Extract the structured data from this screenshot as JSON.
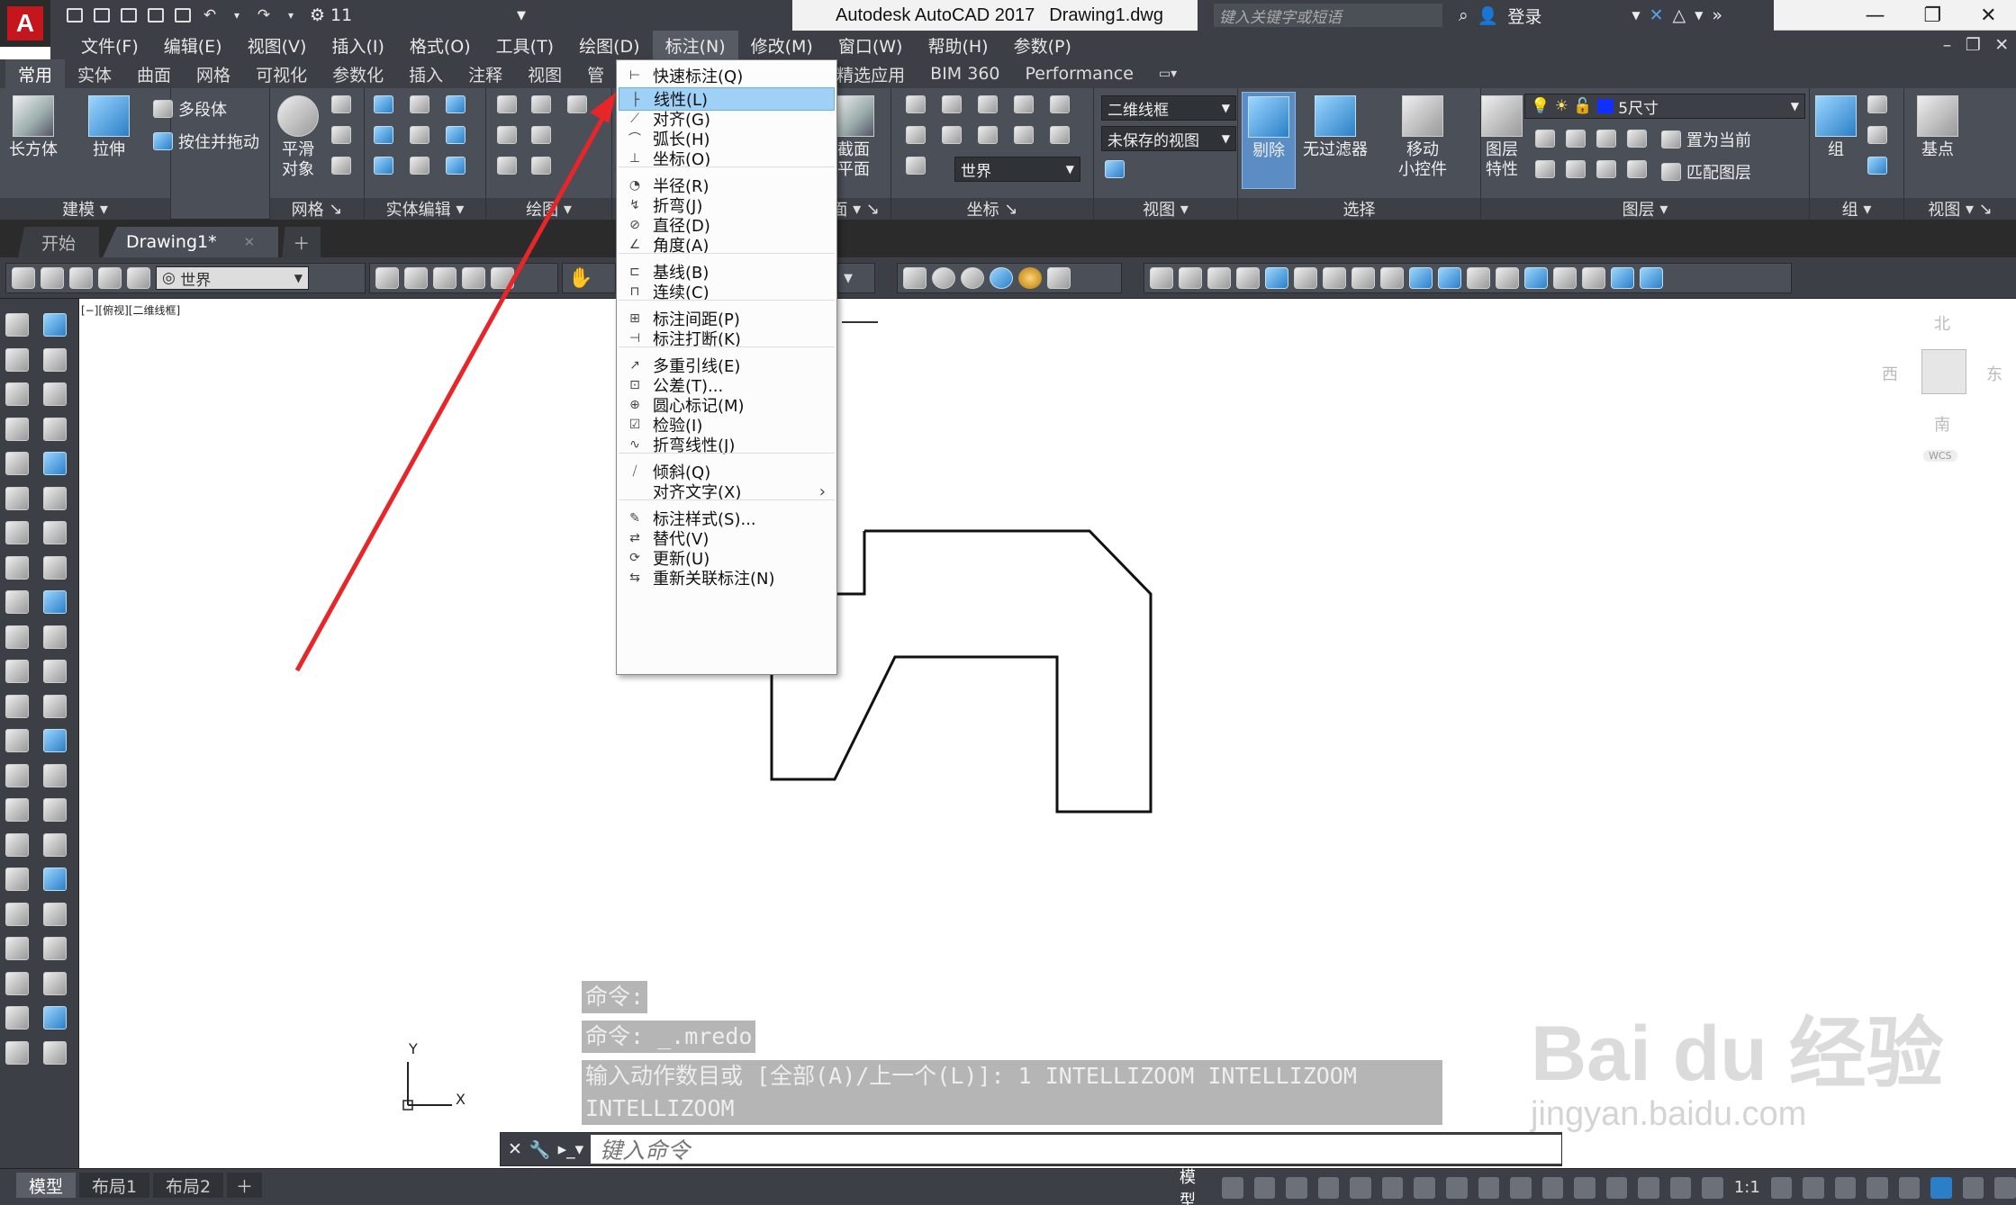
{
  "app": {
    "title": "Autodesk AutoCAD 2017",
    "filename": "Drawing1.dwg",
    "workspace": "11",
    "search_placeholder": "键入关键字或短语",
    "login": "登录"
  },
  "menubar": [
    "文件(F)",
    "编辑(E)",
    "视图(V)",
    "插入(I)",
    "格式(O)",
    "工具(T)",
    "绘图(D)",
    "标注(N)",
    "修改(M)",
    "窗口(W)",
    "帮助(H)",
    "参数(P)"
  ],
  "ribbon_tabs": [
    "常用",
    "实体",
    "曲面",
    "网格",
    "可视化",
    "参数化",
    "插入",
    "注释",
    "视图",
    "管",
    "",
    "精选应用",
    "BIM 360",
    "Performance"
  ],
  "ribbon": {
    "model": {
      "btn1": "长方体",
      "btn2": "拉伸",
      "small1": "多段体",
      "small2": "按住并拖动",
      "title": "建模"
    },
    "mesh": {
      "btn1a": "平滑",
      "btn1b": "对象",
      "title": "网格"
    },
    "solidedit": {
      "title": "实体编辑"
    },
    "draw": {
      "title": "绘图"
    },
    "section": {
      "btn1a": "截面",
      "btn1b": "平面",
      "title": "截面"
    },
    "coords": {
      "world": "世界",
      "title": "坐标"
    },
    "view": {
      "visualstyle": "二维线框",
      "namedview": "未保存的视图",
      "title": "视图"
    },
    "select": {
      "btn1": "剔除",
      "btn2": "无过滤器",
      "btn3a": "移动",
      "btn3b": "小控件",
      "title": "选择"
    },
    "layers": {
      "btn1a": "图层",
      "btn1b": "特性",
      "layer": "5尺寸",
      "setcurrent": "置为当前",
      "match": "匹配图层",
      "title": "图层"
    },
    "group": {
      "btn1": "组",
      "title": "组"
    },
    "viewp": {
      "btn1": "基点",
      "title": "视图"
    }
  },
  "doc_tabs": [
    "开始",
    "Drawing1*"
  ],
  "toolbar2": {
    "ucs": "世界"
  },
  "viewport_label": "[−][俯视][二维线框]",
  "compass": {
    "n": "北",
    "s": "南",
    "e": "东",
    "w": "西",
    "wcs": "WCS"
  },
  "ucs": {
    "x": "X",
    "y": "Y"
  },
  "command": {
    "history": [
      "命令:",
      "命令: _.mredo",
      "输入动作数目或 [全部(A)/上一个(L)]: 1 INTELLIZOOM INTELLIZOOM INTELLIZOOM"
    ],
    "placeholder": "键入命令"
  },
  "layout_tabs": [
    "模型",
    "布局1",
    "布局2"
  ],
  "status": {
    "model": "模型",
    "scale": "1:1"
  },
  "dim_menu": {
    "items": [
      {
        "label": "快速标注(Q)",
        "icon": "quick-dim"
      },
      {
        "label": "线性(L)",
        "icon": "linear",
        "highlight": true
      },
      {
        "label": "对齐(G)",
        "icon": "aligned"
      },
      {
        "label": "弧长(H)",
        "icon": "arc-length"
      },
      {
        "label": "坐标(O)",
        "icon": "ordinate"
      },
      {
        "label": "半径(R)",
        "icon": "radius"
      },
      {
        "label": "折弯(J)",
        "icon": "jogged"
      },
      {
        "label": "直径(D)",
        "icon": "diameter"
      },
      {
        "label": "角度(A)",
        "icon": "angular"
      },
      {
        "label": "基线(B)",
        "icon": "baseline"
      },
      {
        "label": "连续(C)",
        "icon": "continue"
      },
      {
        "label": "标注间距(P)",
        "icon": "space"
      },
      {
        "label": "标注打断(K)",
        "icon": "break"
      },
      {
        "label": "多重引线(E)",
        "icon": "mleader"
      },
      {
        "label": "公差(T)...",
        "icon": "tolerance"
      },
      {
        "label": "圆心标记(M)",
        "icon": "center"
      },
      {
        "label": "检验(I)",
        "icon": "inspect"
      },
      {
        "label": "折弯线性(J)",
        "icon": "jogged-linear"
      },
      {
        "label": "倾斜(Q)",
        "icon": "oblique"
      },
      {
        "label": "对齐文字(X)",
        "icon": "",
        "submenu": true
      },
      {
        "label": "标注样式(S)...",
        "icon": "style"
      },
      {
        "label": "替代(V)",
        "icon": "override"
      },
      {
        "label": "更新(U)",
        "icon": "update"
      },
      {
        "label": "重新关联标注(N)",
        "icon": "reassociate"
      }
    ]
  },
  "watermark": {
    "brand": "Bai du 经验",
    "url": "jingyan.baidu.com"
  },
  "colors": {
    "accent": "#2a7fc8",
    "arrow": "#e8262a",
    "bg_dark": "#3c3f45",
    "ribbon": "#4a4f58"
  }
}
